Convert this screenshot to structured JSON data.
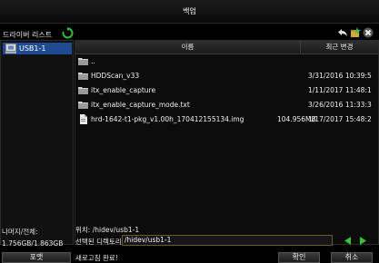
{
  "window": {
    "title": "백업"
  },
  "left": {
    "driver_list_label": "드라이버 리스트",
    "drives": [
      {
        "label": "USB1-1",
        "selected": true
      }
    ],
    "remaining_label": "나머지/전체:",
    "remaining_value": "1.756GB/1.863GB",
    "format_button": "포맷"
  },
  "file_list": {
    "columns": {
      "name": "이름",
      "date": "최근 변경"
    },
    "rows": [
      {
        "icon": "folder-icon",
        "name": "..",
        "size": "",
        "date": ""
      },
      {
        "icon": "folder-icon",
        "name": "HDDScan_v33",
        "size": "",
        "date": "3/31/2016 10:39:5"
      },
      {
        "icon": "folder-icon",
        "name": "itx_enable_capture",
        "size": "",
        "date": "1/11/2017 11:48:1"
      },
      {
        "icon": "folder-icon",
        "name": "itx_enable_capture_mode.txt",
        "size": "",
        "date": "3/26/2016 11:33:3"
      },
      {
        "icon": "file-icon",
        "name": "hrd-1642-t1-pkg_v1.00h_170412155134.img",
        "size": "104.956MB",
        "date": "1/17/2017 15:48:2"
      }
    ]
  },
  "location": {
    "label": "위치:",
    "path": "/hidev/usb1-1"
  },
  "selected_dir": {
    "label": "선택된 디렉토리",
    "value": "/hidev/usb1-1"
  },
  "status": "새로고침 완료!",
  "buttons": {
    "confirm": "확인",
    "cancel": "취소"
  },
  "colors": {
    "selection": "#1e4b92",
    "arrow": "#38c038",
    "refresh": "#38b838"
  }
}
